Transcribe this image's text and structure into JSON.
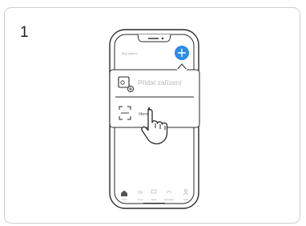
{
  "step": {
    "number": "1"
  },
  "app": {
    "greeting": "Moj domov",
    "add_button_symbol": "+"
  },
  "popup": {
    "add_device_label": "Přidat zařízení",
    "scan_label": "Skenovat"
  },
  "bottom_nav": {
    "items": [
      {
        "label": "Home",
        "icon": "home-icon"
      },
      {
        "label": "Scény",
        "icon": "scenes-icon"
      },
      {
        "label": "Smart",
        "icon": "smart-icon"
      },
      {
        "label": "Automation",
        "icon": "automation-icon"
      },
      {
        "label": "Profil",
        "icon": "profile-icon"
      }
    ]
  },
  "colors": {
    "accent": "#2e8be6",
    "outline": "#2a2a2a"
  }
}
